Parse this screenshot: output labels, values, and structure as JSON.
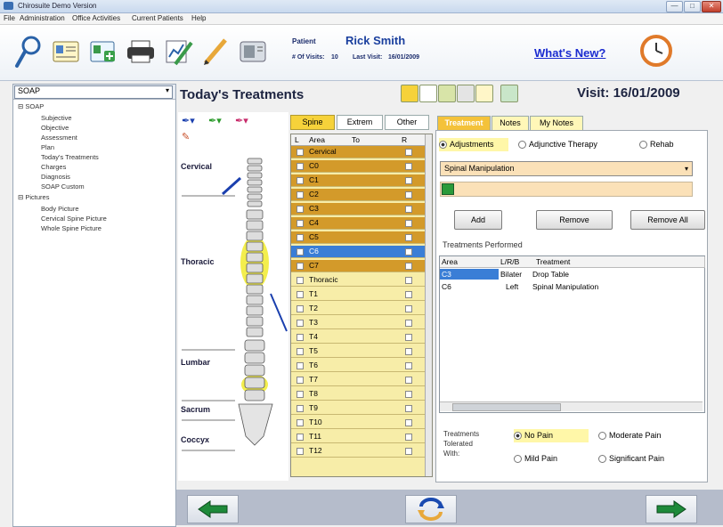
{
  "window": {
    "title": "Chirosuite Demo Version",
    "min": "—",
    "max": "□",
    "close": "✕"
  },
  "menu": [
    "File",
    "Administration",
    "Office Activities",
    "Current Patients",
    "Help"
  ],
  "toolbar": {
    "icons": [
      "search-icon",
      "patient-card-icon",
      "add-patient-icon",
      "printer-icon",
      "chart-edit-icon",
      "pencil-icon",
      "id-card-icon"
    ],
    "patient_label": "Patient",
    "patient_name": "Rick Smith",
    "visits_label": "# Of Visits:",
    "visits_value": "10",
    "last_visit_label": "Last Visit:",
    "last_visit_value": "16/01/2009",
    "whats_new": "What's New?"
  },
  "sidebar": {
    "select_value": "SOAP",
    "soap_root": "SOAP",
    "soap_items": [
      "Subjective",
      "Objective",
      "Assessment",
      "Plan",
      "Today's Treatments",
      "Charges",
      "Diagnosis",
      "SOAP Custom"
    ],
    "pictures_root": "Pictures",
    "picture_items": [
      "Body Picture",
      "Cervical Spine Picture",
      "Whole Spine Picture"
    ]
  },
  "main": {
    "title": "Today's Treatments",
    "visit": "Visit: 16/01/2009",
    "regions": {
      "cervical": "Cervical",
      "thoracic": "Thoracic",
      "lumbar": "Lumbar",
      "sacrum": "Sacrum",
      "coccyx": "Coccyx"
    },
    "spine_tabs": [
      "Spine",
      "Extrem",
      "Other"
    ],
    "list_headers": {
      "l": "L",
      "area": "Area",
      "to": "To",
      "r": "R"
    },
    "list_rows": [
      {
        "name": "Cervical",
        "style": "orange"
      },
      {
        "name": "C0",
        "style": "orange"
      },
      {
        "name": "C1",
        "style": "orange"
      },
      {
        "name": "C2",
        "style": "orange"
      },
      {
        "name": "C3",
        "style": "orange"
      },
      {
        "name": "C4",
        "style": "orange"
      },
      {
        "name": "C5",
        "style": "orange"
      },
      {
        "name": "C6",
        "style": "sel"
      },
      {
        "name": "C7",
        "style": "orange"
      },
      {
        "name": "Thoracic",
        "style": "plain"
      },
      {
        "name": "T1",
        "style": "plain"
      },
      {
        "name": "T2",
        "style": "plain"
      },
      {
        "name": "T3",
        "style": "plain"
      },
      {
        "name": "T4",
        "style": "plain"
      },
      {
        "name": "T5",
        "style": "plain"
      },
      {
        "name": "T6",
        "style": "plain"
      },
      {
        "name": "T7",
        "style": "plain"
      },
      {
        "name": "T8",
        "style": "plain"
      },
      {
        "name": "T9",
        "style": "plain"
      },
      {
        "name": "T10",
        "style": "plain"
      },
      {
        "name": "T11",
        "style": "plain"
      },
      {
        "name": "T12",
        "style": "plain"
      }
    ]
  },
  "right": {
    "tabs": [
      "Treatment",
      "Notes",
      "My Notes"
    ],
    "radio_adjustments": "Adjustments",
    "radio_adjunctive": "Adjunctive Therapy",
    "radio_rehab": "Rehab",
    "technique_value": "Spinal Manipulation",
    "add": "Add",
    "remove": "Remove",
    "remove_all": "Remove All",
    "performed_label": "Treatments Performed",
    "grid_headers": [
      "Area",
      "L/R/B",
      "Treatment"
    ],
    "grid_rows": [
      [
        "C3",
        "Bilater",
        "Drop Table"
      ],
      [
        "C6",
        "Left",
        "Spinal Manipulation"
      ]
    ],
    "tolerated_label": "Treatments Tolerated With:",
    "pain_no": "No Pain",
    "pain_moderate": "Moderate Pain",
    "pain_mild": "Mild Pain",
    "pain_significant": "Significant Pain"
  },
  "bottom": {
    "back": "back-arrow-icon",
    "refresh": "refresh-icon",
    "forward": "forward-arrow-icon"
  },
  "colors": {
    "highlight": "#f2ec3a",
    "orange": "#d39a2a",
    "selection": "#3a7ed6",
    "list_bg": "#f7eda8"
  }
}
